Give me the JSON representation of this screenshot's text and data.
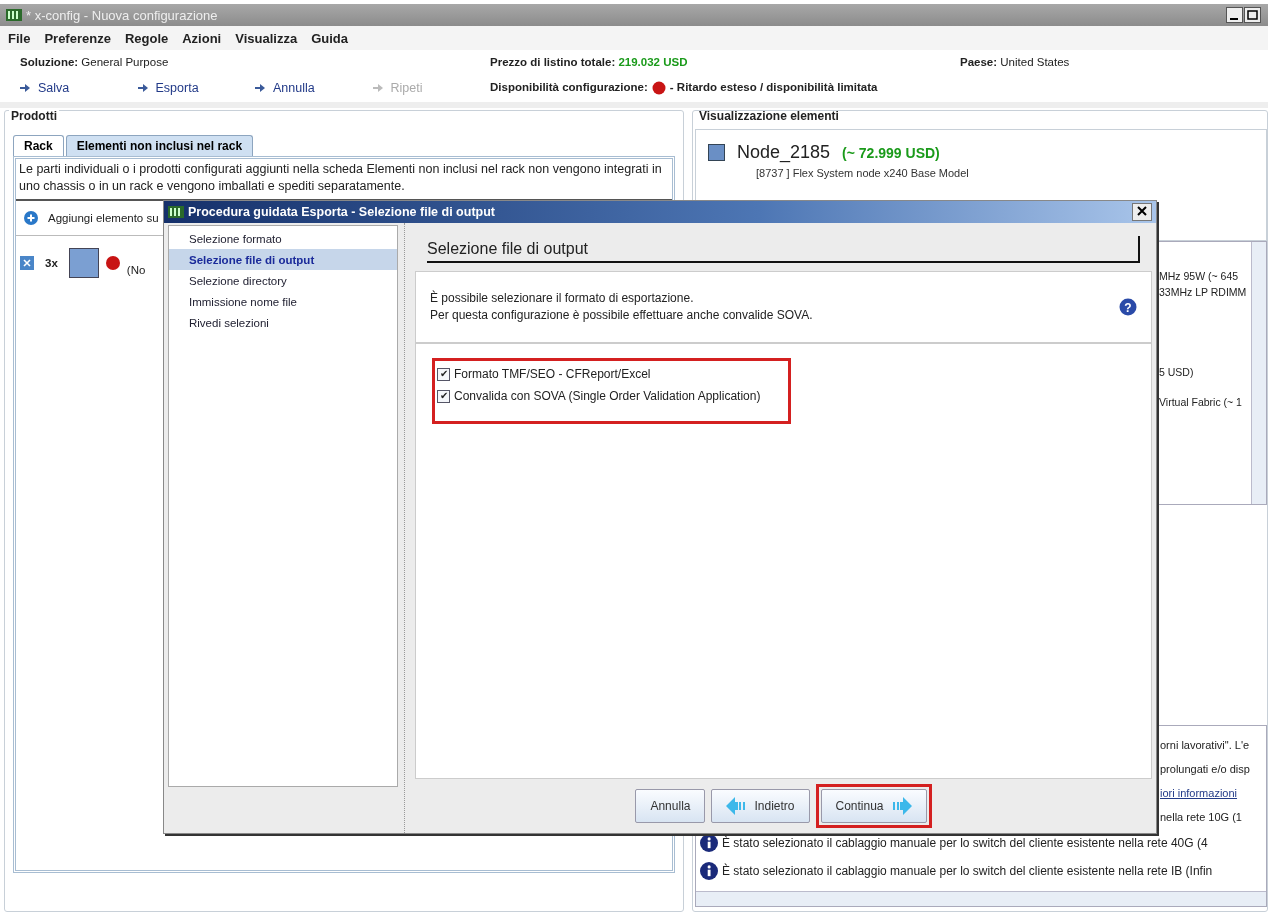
{
  "window": {
    "title": "* x-config - Nuova configurazione"
  },
  "menu": [
    "File",
    "Preferenze",
    "Regole",
    "Azioni",
    "Visualizza",
    "Guida"
  ],
  "info": {
    "solution_label": "Soluzione:",
    "solution": "General Purpose",
    "price_label": "Prezzo di listino totale:",
    "price": "219.032 USD",
    "country_label": "Paese:",
    "country": "United States"
  },
  "actions": [
    {
      "label": "Salva",
      "disabled": false
    },
    {
      "label": "Esporta",
      "disabled": false
    },
    {
      "label": "Annulla",
      "disabled": false
    },
    {
      "label": "Ripeti",
      "disabled": true
    }
  ],
  "availability": {
    "label": "Disponibilità configurazione:",
    "status": "- Ritardo esteso / disponibilità limitata"
  },
  "products": {
    "title": "Prodotti",
    "tabs": [
      {
        "label": "Rack",
        "selected": false
      },
      {
        "label": "Elementi non inclusi nel rack",
        "selected": true
      }
    ],
    "description": "Le parti individuali o i prodotti configurati aggiunti nella scheda Elementi non inclusi nel rack non vengono integrati in uno chassis o in un rack e vengono imballati e spediti separatamente.",
    "add_label": "Aggiungi elemento su",
    "rows": [
      {
        "quantity": "3x",
        "note": "(No"
      }
    ]
  },
  "elements": {
    "title": "Visualizzazione elementi",
    "node": {
      "name": "Node_2185",
      "price": "(~ 72.999 USD)",
      "model": "[8737 ] Flex System node x240  Base Model"
    },
    "groups": [
      {
        "lines": [
          "MHz 95W (~ 645",
          "33MHz LP RDIMM"
        ]
      },
      {
        "lines": [
          "5 USD)"
        ]
      },
      {
        "lines": [
          "Virtual Fabric (~ 1"
        ]
      }
    ],
    "messages": [
      {
        "kind": "fragment",
        "text": "orni lavorativi\". L'e"
      },
      {
        "kind": "fragment",
        "text": "prolungati e/o disp"
      },
      {
        "kind": "link",
        "text": "iori informazioni"
      },
      {
        "kind": "fragment",
        "text": "nella rete 10G (1"
      },
      {
        "kind": "info",
        "text": "È stato selezionato il cablaggio manuale per lo switch del cliente esistente nella rete 40G (4"
      },
      {
        "kind": "info",
        "text": "È stato selezionato il cablaggio manuale per lo switch del cliente esistente nella rete IB (Infin"
      }
    ]
  },
  "dialog": {
    "title": "Procedura guidata Esporta - Selezione file di output",
    "steps": [
      {
        "label": "Selezione formato",
        "selected": false
      },
      {
        "label": "Selezione file di output",
        "selected": true
      },
      {
        "label": "Selezione directory",
        "selected": false
      },
      {
        "label": "Immissione nome file",
        "selected": false
      },
      {
        "label": "Rivedi selezioni",
        "selected": false
      }
    ],
    "heading": "Selezione file di output",
    "help_glyph": "?",
    "check_glyph": "✔",
    "description": [
      "È possibile selezionare il formato di esportazione.",
      "Per questa configurazione è possibile effettuare anche convalide SOVA."
    ],
    "options": [
      {
        "label": "Formato TMF/SEO - CFReport/Excel",
        "checked": true
      },
      {
        "label": "Convalida con SOVA (Single Order Validation Application)",
        "checked": true
      }
    ],
    "buttons": [
      {
        "kind": "plain",
        "label": "Annulla"
      },
      {
        "kind": "back",
        "label": "Indietro"
      },
      {
        "kind": "next",
        "label": "Continua"
      }
    ]
  }
}
